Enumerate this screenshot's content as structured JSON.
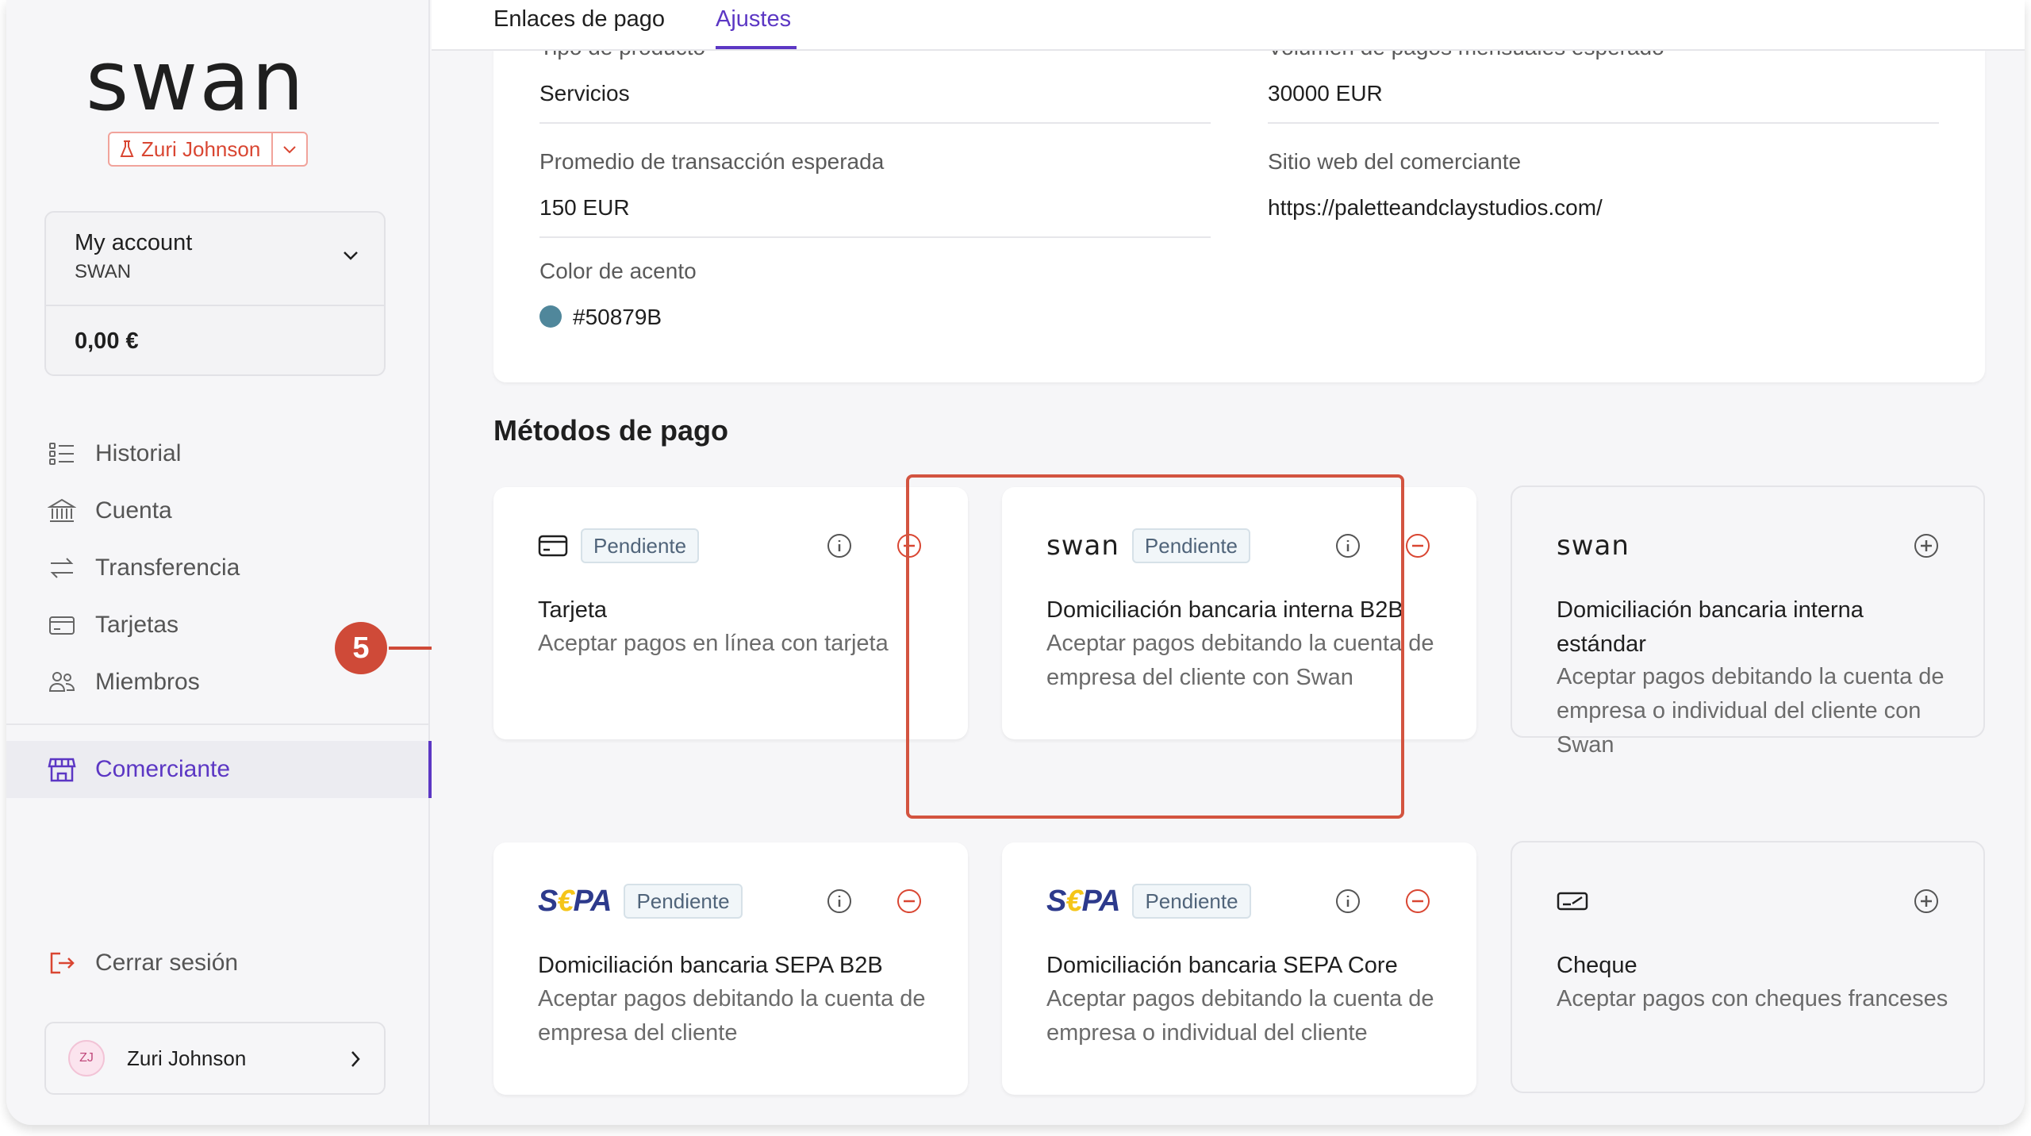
{
  "sidebar": {
    "user_chip": "Zuri Johnson",
    "account": {
      "name": "My account",
      "sub": "SWAN",
      "balance": "0,00 €"
    },
    "nav": [
      {
        "label": "Historial",
        "icon": "list-icon"
      },
      {
        "label": "Cuenta",
        "icon": "bank-icon"
      },
      {
        "label": "Transferencia",
        "icon": "transfer-icon"
      },
      {
        "label": "Tarjetas",
        "icon": "card-icon"
      },
      {
        "label": "Miembros",
        "icon": "members-icon"
      }
    ],
    "active": {
      "label": "Comerciante",
      "icon": "store-icon"
    },
    "logout": "Cerrar sesión",
    "profile": {
      "initials": "ZJ",
      "name": "Zuri Johnson"
    }
  },
  "callout": "5",
  "tabs": {
    "links": "Enlaces de pago",
    "settings": "Ajustes"
  },
  "info": {
    "product_type": {
      "label": "Tipo de producto",
      "value": "Servicios"
    },
    "volume": {
      "label": "Volumen de pagos mensuales esperado",
      "value": "30000 EUR"
    },
    "avg": {
      "label": "Promedio de transacción esperada",
      "value": "150 EUR"
    },
    "website": {
      "label": "Sitio web del comerciante",
      "value": "https://paletteandclaystudios.com/"
    },
    "accent": {
      "label": "Color de acento",
      "value": "#50879B"
    }
  },
  "section_title": "Métodos de pago",
  "methods": [
    {
      "brand": "card-icon",
      "badge": "Pendiente",
      "title": "Tarjeta",
      "desc": "Aceptar pagos en línea con tarjeta",
      "action": "remove"
    },
    {
      "brand": "swan",
      "badge": "Pendiente",
      "title": "Domiciliación bancaria interna B2B",
      "desc": "Aceptar pagos debitando la cuenta de empresa del cliente con Swan",
      "action": "remove"
    },
    {
      "brand": "swan",
      "badge": "",
      "title": "Domiciliación bancaria interna estándar",
      "desc": "Aceptar pagos debitando la cuenta de empresa o individual del cliente con Swan",
      "action": "add"
    },
    {
      "brand": "SEPA",
      "badge": "Pendiente",
      "title": "Domiciliación bancaria SEPA B2B",
      "desc": "Aceptar pagos debitando la cuenta de empresa del cliente",
      "action": "remove"
    },
    {
      "brand": "SEPA",
      "badge": "Pendiente",
      "title": "Domiciliación bancaria SEPA Core",
      "desc": "Aceptar pagos debitando la cuenta de empresa o individual del cliente",
      "action": "remove"
    },
    {
      "brand": "check-icon",
      "badge": "",
      "title": "Cheque",
      "desc": "Aceptar pagos con cheques franceses",
      "action": "add"
    }
  ],
  "colors": {
    "accent": "#5c37c4",
    "danger": "#d94632",
    "sample": "#50879B"
  }
}
